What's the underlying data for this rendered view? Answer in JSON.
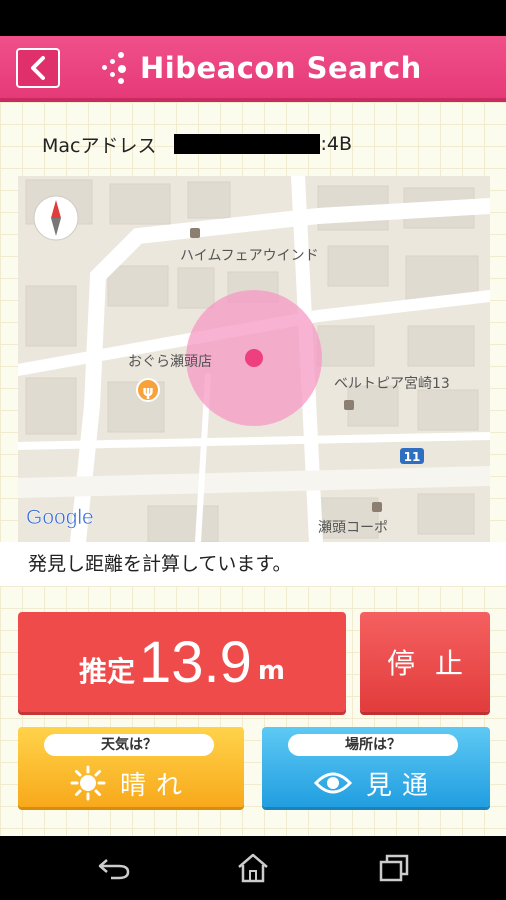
{
  "header": {
    "title": "Hibeacon Search"
  },
  "device": {
    "mac_label": "Macアドレス",
    "mac_suffix": ":4B"
  },
  "map": {
    "labels": {
      "building1": "ハイムフェアウインド",
      "restaurant": "おぐら瀬頭店",
      "building2": "ベルトピア宮崎13",
      "building3": "瀬頭コーポ",
      "route_number": "11"
    },
    "google_logo": "Google",
    "icons": [
      "compass-icon",
      "restaurant-icon",
      "beacon-range-circle",
      "route-shield-icon"
    ]
  },
  "status": {
    "message": "発見し距離を計算しています。"
  },
  "distance": {
    "prefix": "推定",
    "value": "13.9",
    "unit": "m"
  },
  "buttons": {
    "stop_label": "停止"
  },
  "weather": {
    "question": "天気は？",
    "value": "晴れ",
    "icon": "sun-icon"
  },
  "place": {
    "question": "場所は？",
    "value": "見通",
    "icon": "eye-icon"
  },
  "navbar": {
    "icons": [
      "back-icon",
      "home-icon",
      "recent-apps-icon"
    ]
  },
  "colors": {
    "header": "#e63a78",
    "distance_card": "#f04b4b",
    "weather_card": "#f8a91b",
    "place_card": "#219ee0",
    "beacon_circle": "#f59ac4"
  }
}
